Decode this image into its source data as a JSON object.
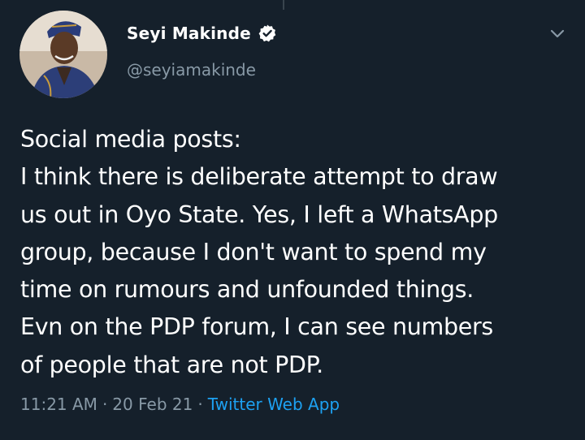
{
  "author": {
    "display_name": "Seyi Makinde",
    "handle": "@seyiamakinde",
    "verified": true,
    "avatar_icon": "profile-photo"
  },
  "tweet": {
    "lines": [
      "Social media posts:",
      "I think there is deliberate attempt to draw",
      "us out in Oyo State. Yes, I left a WhatsApp",
      "group, because I don't want to spend my",
      "time on rumours and unfounded things.",
      "Evn on the PDP forum, I can see numbers",
      "of people that are not PDP."
    ]
  },
  "meta": {
    "time": "11:21 AM",
    "separator": "·",
    "date": "20 Feb 21",
    "source": "Twitter Web App"
  },
  "icons": {
    "verified": "verified-badge-icon",
    "more": "chevron-down-icon"
  },
  "colors": {
    "background": "#15202b",
    "text_primary": "#ffffff",
    "text_secondary": "#8899a6",
    "link": "#1da1f2"
  }
}
